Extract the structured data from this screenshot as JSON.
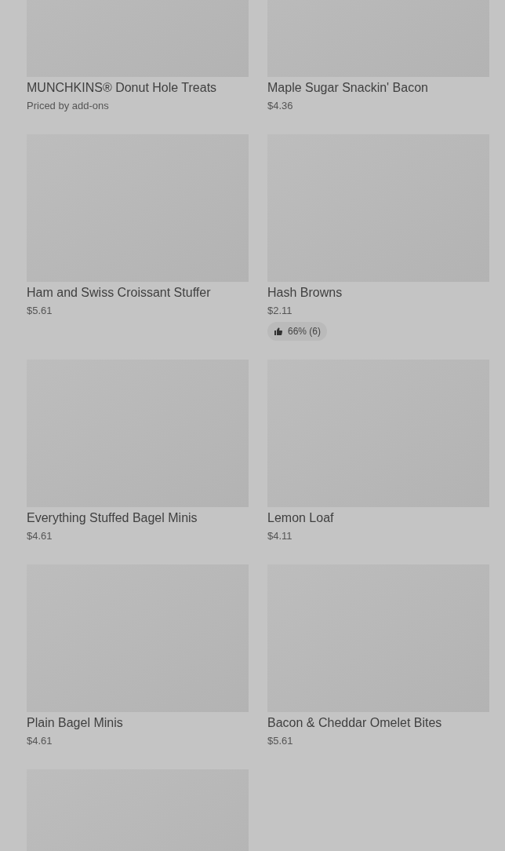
{
  "items": [
    {
      "kind": "product",
      "name": "MUNCHKINS® Donut Hole Treats",
      "price": "Priced by add-ons"
    },
    {
      "kind": "product",
      "name": "Maple Sugar Snackin' Bacon",
      "price": "$4.36"
    },
    {
      "kind": "product",
      "name": "Ham and Swiss Croissant Stuffer",
      "price": "$5.61"
    },
    {
      "kind": "product",
      "name": "Hash Browns",
      "price": "$2.11",
      "rating": "66% (6)"
    },
    {
      "kind": "product",
      "name": "Everything Stuffed Bagel Minis",
      "price": "$4.61"
    },
    {
      "kind": "product",
      "name": "Lemon Loaf",
      "price": "$4.11"
    },
    {
      "kind": "product",
      "name": "Plain Bagel Minis",
      "price": "$4.61"
    },
    {
      "kind": "product",
      "name": "Bacon & Cheddar Omelet Bites",
      "price": "$5.61"
    },
    {
      "kind": "image-only"
    }
  ]
}
